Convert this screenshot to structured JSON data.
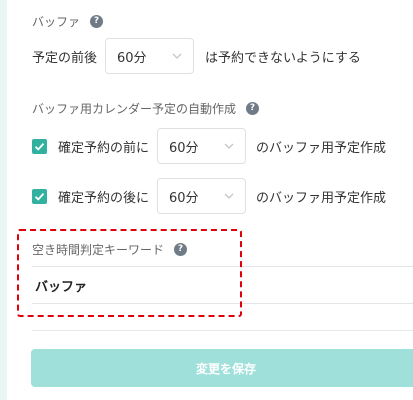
{
  "buffer": {
    "title": "バッファ",
    "row_label": "予定の前後",
    "select_value": "60分",
    "row_suffix": "は予約できないようにする"
  },
  "auto_create": {
    "title": "バッファ用カレンダー予定の自動作成",
    "before": {
      "checked": true,
      "label": "確定予約の前に",
      "select_value": "60分",
      "suffix": "のバッファ用予定作成"
    },
    "after": {
      "checked": true,
      "label": "確定予約の後に",
      "select_value": "60分",
      "suffix": "のバッファ用予定作成"
    }
  },
  "keyword": {
    "title": "空き時間判定キーワード",
    "value": "バッファ"
  },
  "save_button": {
    "label": "変更を保存"
  },
  "colors": {
    "accent": "#32b1a1",
    "save_button_bg": "#9fe0db",
    "highlight": "#e0000a",
    "help_icon": "#6f7b86"
  },
  "icons": {
    "help": "question-circle-icon",
    "dropdown": "chevron-down-icon",
    "check": "checkmark-icon"
  }
}
